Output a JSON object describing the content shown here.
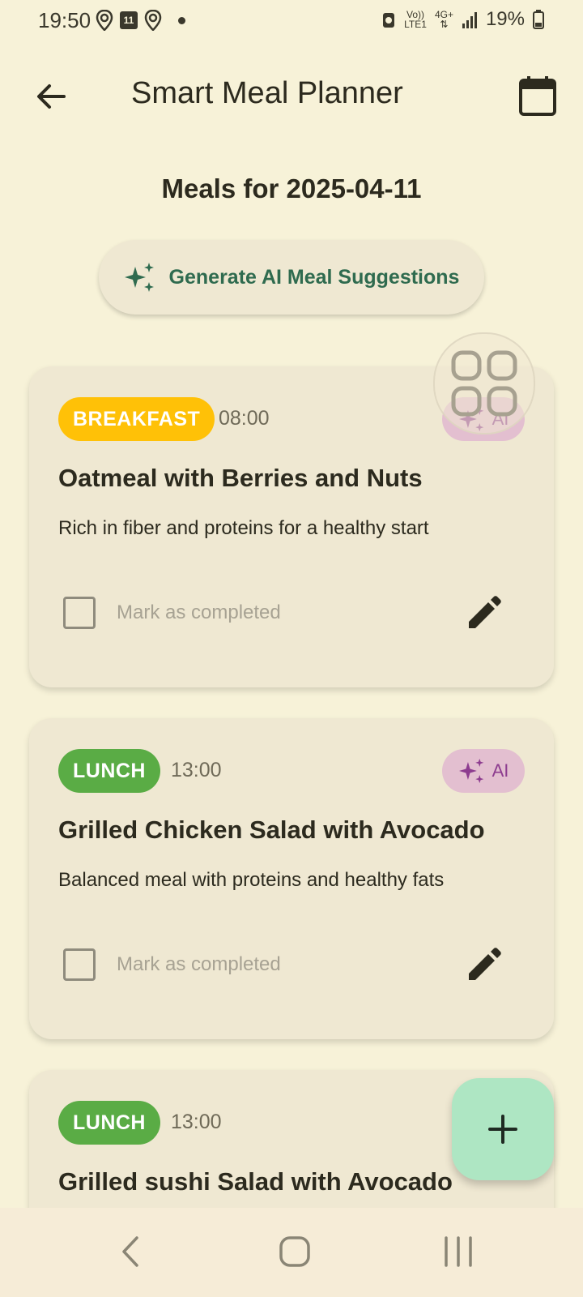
{
  "status": {
    "time": "19:50",
    "calendar_day": "11",
    "volte_top": "Vo))",
    "volte_bottom": "LTE1",
    "network": "4G+",
    "battery": "19%"
  },
  "app_bar": {
    "title": "Smart Meal Planner"
  },
  "date_heading": "Meals for 2025-04-11",
  "ai_button_label": "Generate AI Meal Suggestions",
  "meals": [
    {
      "type": "BREAKFAST",
      "type_color": "#ffc107",
      "time": "08:00",
      "ai_label": "AI",
      "title": "Oatmeal with Berries and Nuts",
      "description": "Rich in fiber and proteins for a healthy start",
      "completed_label": "Mark as completed"
    },
    {
      "type": "LUNCH",
      "type_color": "#5aac45",
      "time": "13:00",
      "ai_label": "AI",
      "title": "Grilled Chicken Salad with Avocado",
      "description": "Balanced meal with proteins and healthy fats",
      "completed_label": "Mark as completed"
    },
    {
      "type": "LUNCH",
      "type_color": "#5aac45",
      "time": "13:00",
      "title": "Grilled sushi Salad with Avocado"
    }
  ],
  "icons": {
    "back": "arrow-back-icon",
    "calendar": "calendar-icon",
    "sparkle": "sparkle-icon",
    "edit": "pencil-icon",
    "add": "plus-icon"
  },
  "colors": {
    "background": "#f7f2d8",
    "card": "#efe8d2",
    "accent_green": "#2f6b4f",
    "fab": "#aee6c3",
    "ai_badge": "#e3bfd0"
  }
}
